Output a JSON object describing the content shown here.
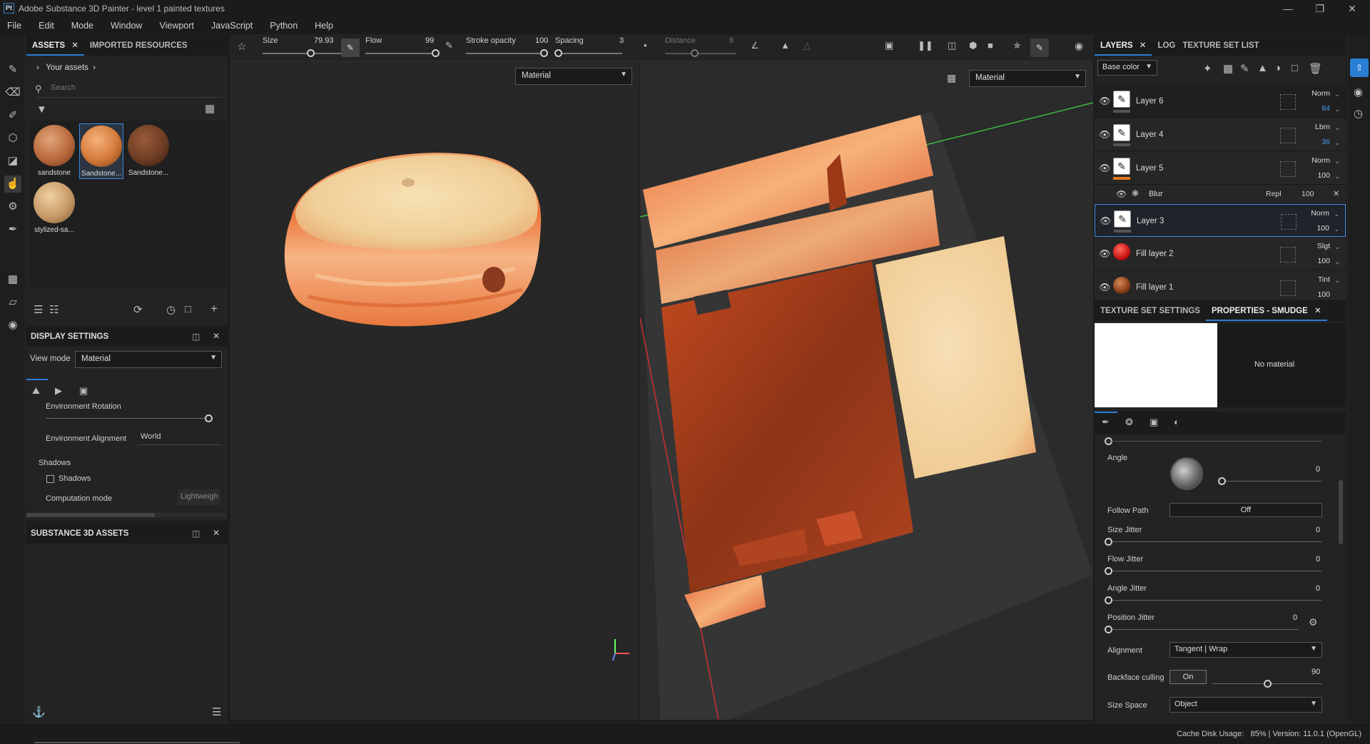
{
  "app": {
    "title": "Adobe Substance 3D Painter - level 1 painted textures",
    "logo": "Pt"
  },
  "menu": [
    "File",
    "Edit",
    "Mode",
    "Window",
    "Viewport",
    "JavaScript",
    "Python",
    "Help"
  ],
  "assets": {
    "tabs": [
      "ASSETS",
      "IMPORTED RESOURCES"
    ],
    "breadcrumb": "Your assets",
    "search_placeholder": "Search",
    "items": [
      {
        "label": "sandstone",
        "color": "#b86a3d"
      },
      {
        "label": "Sandstone...",
        "color": "#d47a3a"
      },
      {
        "label": "Sandstone...",
        "color": "#6e3d25"
      },
      {
        "label": "stylized-sa...",
        "color": "#c79a68"
      }
    ]
  },
  "display": {
    "title": "DISPLAY SETTINGS",
    "view_mode_label": "View mode",
    "view_mode_value": "Material",
    "env_rotation_label": "Environment Rotation",
    "env_alignment_label": "Environment Alignment",
    "env_alignment_value": "World",
    "shadows_section": "Shadows",
    "shadows_checkbox": "Shadows",
    "computation_label": "Computation mode",
    "computation_value": "Lightweigh"
  },
  "s3d_assets": {
    "title": "SUBSTANCE 3D ASSETS"
  },
  "toolbar": {
    "size_label": "Size",
    "size_value": "79.93",
    "flow_label": "Flow",
    "flow_value": "99",
    "stroke_label": "Stroke opacity",
    "stroke_value": "100",
    "spacing_label": "Spacing",
    "spacing_value": "3",
    "distance_label": "Distance",
    "distance_value": "8",
    "size_level": 0.62,
    "flow_level": 0.99,
    "stroke_level": 1.0
  },
  "viewport3d": {
    "mode": "Material"
  },
  "viewport2d": {
    "mode": "Material"
  },
  "layers": {
    "tabs": [
      "LAYERS",
      "LOG",
      "TEXTURE SET LIST"
    ],
    "channel": "Base color",
    "items": [
      {
        "name": "Layer 6",
        "blend": "Norm",
        "opacity": "84",
        "opacity_color": "#4a9df0",
        "type": "paint"
      },
      {
        "name": "Layer 4",
        "blend": "Lbrn",
        "opacity": "36",
        "opacity_color": "#4a9df0",
        "type": "paint"
      },
      {
        "name": "Layer 5",
        "blend": "Norm",
        "opacity": "100",
        "opacity_color": "#dddddd",
        "type": "paint"
      },
      {
        "name": "Layer 3",
        "blend": "Norm",
        "opacity": "100",
        "opacity_color": "#dddddd",
        "type": "paint"
      },
      {
        "name": "Fill layer 2",
        "blend": "Slgt",
        "opacity": "100",
        "opacity_color": "#dddddd",
        "type": "fill-red"
      },
      {
        "name": "Fill layer 1",
        "blend": "Tint",
        "opacity": "100",
        "opacity_color": "#dddddd",
        "type": "fill-brown"
      }
    ],
    "effect": {
      "name": "Blur",
      "blend": "Repl",
      "opacity": "100"
    }
  },
  "properties": {
    "tabs": [
      "TEXTURE SET SETTINGS",
      "PROPERTIES - SMUDGE"
    ],
    "no_material": "No material",
    "angle_label": "Angle",
    "angle_value": "0",
    "follow_path_label": "Follow Path",
    "follow_path_value": "Off",
    "size_jitter_label": "Size Jitter",
    "size_jitter_value": "0",
    "flow_jitter_label": "Flow Jitter",
    "flow_jitter_value": "0",
    "angle_jitter_label": "Angle Jitter",
    "angle_jitter_value": "0",
    "position_jitter_label": "Position Jitter",
    "position_jitter_value": "0",
    "alignment_label": "Alignment",
    "alignment_value": "Tangent | Wrap",
    "backface_label": "Backface culling",
    "backface_toggle": "On",
    "backface_value": "90",
    "size_space_label": "Size Space",
    "size_space_value": "Object"
  },
  "status": {
    "text": "Cache Disk Usage:   85% | Version: 11.0.1 (OpenGL)"
  },
  "colors": {
    "accent": "#2a7fd4",
    "panel": "#232323",
    "background": "#1b1b1b"
  }
}
